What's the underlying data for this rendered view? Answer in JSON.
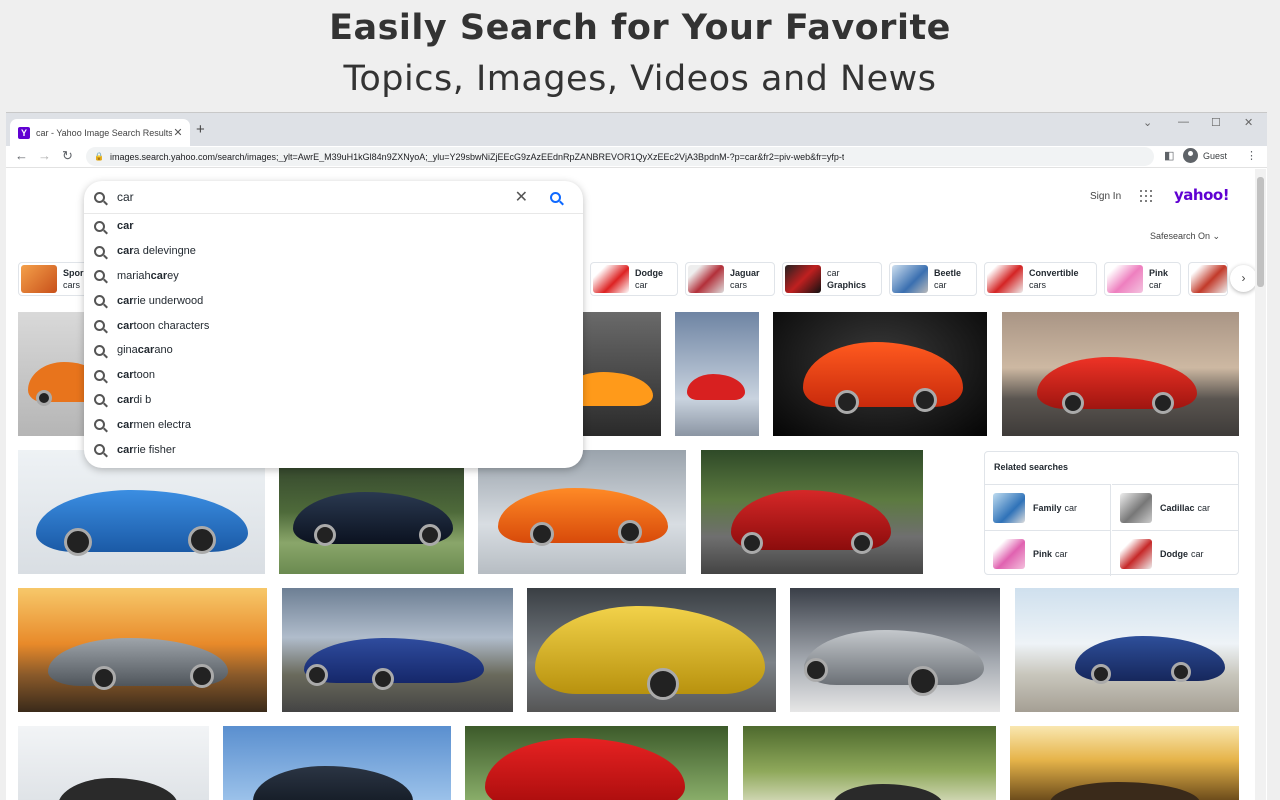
{
  "hero": {
    "line1": "Easily Search for Your Favorite",
    "line2": "Topics, Images, Videos and News"
  },
  "browser": {
    "tab_title": "car - Yahoo Image Search Results",
    "favicon_letter": "Y",
    "url": "images.search.yahoo.com/search/images;_ylt=AwrE_M39uH1kGl84n9ZXNyoA;_ylu=Y29sbwNiZjEEcG9zAzEEdnRpZANBREVOR1QyXzEEc2VjA3BpdnM-?p=car&fr2=piv-web&fr=yfp-t",
    "profile_label": "Guest",
    "icons": {
      "back": "back-arrow-icon",
      "forward": "forward-arrow-icon",
      "reload": "reload-icon"
    }
  },
  "page": {
    "search_query": "car",
    "sign_in": "Sign In",
    "logo": "yahoo!",
    "safesearch": "Safesearch On",
    "suggestions": [
      {
        "bold": "car",
        "rest": ""
      },
      {
        "bold": "car",
        "rest": "a delevingne"
      },
      {
        "pre": "mariah ",
        "bold": "car",
        "rest": "ey"
      },
      {
        "bold": "car",
        "rest": "rie underwood"
      },
      {
        "bold": "car",
        "rest": "toon characters"
      },
      {
        "pre": "gina ",
        "bold": "car",
        "rest": "ano"
      },
      {
        "bold": "car",
        "rest": "toon"
      },
      {
        "bold": "car",
        "rest": "di b"
      },
      {
        "bold": "car",
        "rest": "men electra"
      },
      {
        "bold": "car",
        "rest": "rie fisher"
      }
    ],
    "pills": [
      {
        "bold": "Spor",
        "line2": "cars",
        "thumb": "#e87a2a"
      },
      {
        "bold": "Dodge",
        "line2": "car",
        "thumb": "#c81e1e"
      },
      {
        "bold": "Jaguar",
        "line2": "cars",
        "thumb": "#b3303a"
      },
      {
        "top": "car",
        "bold": "Graphics",
        "thumb": "#a02020"
      },
      {
        "bold": "Beetle",
        "line2": "car",
        "thumb": "#3a6fb0"
      },
      {
        "bold": "Convertible",
        "line2": "cars",
        "thumb": "#d42424"
      },
      {
        "bold": "Pink",
        "line2": "car",
        "thumb": "#ee7fbf"
      },
      {
        "bold": "",
        "line2": "",
        "thumb": "#c23a2a"
      }
    ],
    "related": {
      "title": "Related searches",
      "items": [
        {
          "bold": "Family",
          "rest": "car",
          "thumb": "#5a92c8"
        },
        {
          "bold": "Cadillac",
          "rest": "car",
          "thumb": "#8c8c8c"
        },
        {
          "bold": "Pink",
          "rest": "car",
          "thumb": "#e062b0"
        },
        {
          "bold": "Dodge",
          "rest": "car",
          "thumb": "#c62828"
        }
      ]
    }
  },
  "colors": {
    "yahoo_purple": "#6001d2",
    "search_blue": "#0f69ff"
  }
}
